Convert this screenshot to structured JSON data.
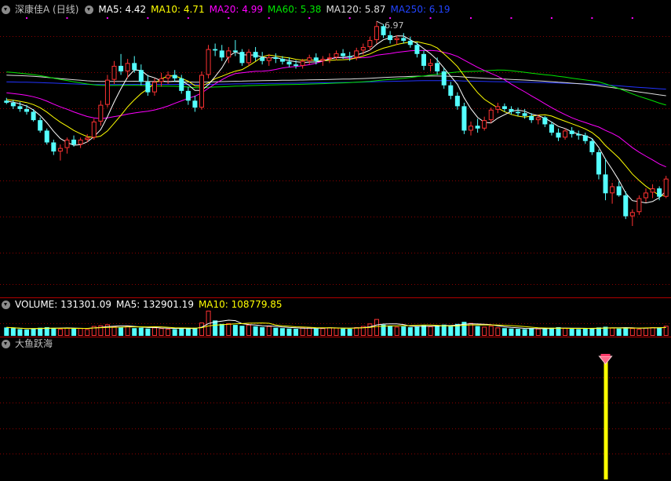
{
  "main_legend": {
    "stock": "深康佳A (日线)",
    "ma5": "MA5: 4.42",
    "ma10": "MA10: 4.71",
    "ma20": "MA20: 4.99",
    "ma60": "MA60: 5.38",
    "ma120": "MA120: 5.87",
    "ma250": "MA250: 6.19"
  },
  "volume_legend": {
    "vol": "VOLUME: 131301.09",
    "ma5": "MA5: 132901.19",
    "ma10": "MA10: 108779.85"
  },
  "indicator_legend": {
    "name": "大鱼跃海"
  },
  "colors": {
    "up": "#ff3232",
    "down": "#54ffff",
    "ma5": "#ffffff",
    "ma10": "#ffff00",
    "ma20": "#ff00ff",
    "ma60": "#00e600",
    "ma120": "#dddddd",
    "ma250": "#2233ff",
    "signal": "#ffff00",
    "grid": "#8b0000"
  },
  "chart_data": {
    "type": "candlestick",
    "peak_label": "6.97",
    "price_ylim": [
      3.2,
      7.2
    ],
    "candles": [
      [
        5.98,
        6.02,
        5.93,
        5.95
      ],
      [
        5.95,
        5.99,
        5.86,
        5.9
      ],
      [
        5.9,
        5.96,
        5.82,
        5.86
      ],
      [
        5.86,
        5.92,
        5.78,
        5.82
      ],
      [
        5.82,
        5.86,
        5.68,
        5.7
      ],
      [
        5.7,
        5.74,
        5.52,
        5.55
      ],
      [
        5.55,
        5.58,
        5.35,
        5.38
      ],
      [
        5.38,
        5.42,
        5.2,
        5.25
      ],
      [
        5.25,
        5.35,
        5.12,
        5.3
      ],
      [
        5.3,
        5.45,
        5.22,
        5.42
      ],
      [
        5.42,
        5.48,
        5.32,
        5.35
      ],
      [
        5.35,
        5.45,
        5.3,
        5.42
      ],
      [
        5.42,
        5.5,
        5.38,
        5.45
      ],
      [
        5.45,
        5.72,
        5.42,
        5.68
      ],
      [
        5.68,
        5.98,
        5.62,
        5.92
      ],
      [
        5.92,
        6.35,
        5.88,
        6.28
      ],
      [
        6.28,
        6.55,
        6.22,
        6.48
      ],
      [
        6.48,
        6.65,
        6.35,
        6.4
      ],
      [
        6.4,
        6.58,
        6.3,
        6.52
      ],
      [
        6.52,
        6.62,
        6.38,
        6.42
      ],
      [
        6.42,
        6.5,
        6.2,
        6.25
      ],
      [
        6.25,
        6.35,
        6.05,
        6.1
      ],
      [
        6.1,
        6.3,
        6.05,
        6.25
      ],
      [
        6.25,
        6.38,
        6.18,
        6.3
      ],
      [
        6.3,
        6.4,
        6.22,
        6.35
      ],
      [
        6.35,
        6.42,
        6.25,
        6.3
      ],
      [
        6.3,
        6.35,
        6.08,
        6.12
      ],
      [
        6.12,
        6.18,
        5.92,
        5.98
      ],
      [
        5.98,
        6.05,
        5.82,
        5.88
      ],
      [
        5.88,
        6.4,
        5.85,
        6.35
      ],
      [
        6.35,
        6.78,
        6.3,
        6.72
      ],
      [
        6.72,
        6.8,
        6.62,
        6.7
      ],
      [
        6.7,
        6.78,
        6.55,
        6.6
      ],
      [
        6.6,
        6.75,
        6.52,
        6.7
      ],
      [
        6.7,
        6.85,
        6.62,
        6.68
      ],
      [
        6.68,
        6.72,
        6.48,
        6.52
      ],
      [
        6.52,
        6.72,
        6.48,
        6.68
      ],
      [
        6.68,
        6.75,
        6.55,
        6.6
      ],
      [
        6.6,
        6.68,
        6.5,
        6.55
      ],
      [
        6.55,
        6.65,
        6.48,
        6.6
      ],
      [
        6.6,
        6.66,
        6.52,
        6.58
      ],
      [
        6.58,
        6.62,
        6.5,
        6.54
      ],
      [
        6.54,
        6.6,
        6.46,
        6.5
      ],
      [
        6.5,
        6.56,
        6.44,
        6.48
      ],
      [
        6.48,
        6.58,
        6.44,
        6.55
      ],
      [
        6.55,
        6.64,
        6.5,
        6.6
      ],
      [
        6.6,
        6.66,
        6.5,
        6.55
      ],
      [
        6.55,
        6.62,
        6.48,
        6.58
      ],
      [
        6.58,
        6.66,
        6.52,
        6.6
      ],
      [
        6.6,
        6.7,
        6.56,
        6.66
      ],
      [
        6.66,
        6.72,
        6.58,
        6.62
      ],
      [
        6.62,
        6.68,
        6.55,
        6.6
      ],
      [
        6.6,
        6.74,
        6.56,
        6.7
      ],
      [
        6.7,
        6.8,
        6.64,
        6.75
      ],
      [
        6.75,
        6.9,
        6.7,
        6.85
      ],
      [
        6.85,
        7.12,
        6.8,
        7.05
      ],
      [
        7.05,
        7.08,
        6.88,
        6.92
      ],
      [
        6.92,
        6.98,
        6.8,
        6.85
      ],
      [
        6.85,
        6.92,
        6.78,
        6.88
      ],
      [
        6.88,
        6.95,
        6.8,
        6.84
      ],
      [
        6.84,
        6.9,
        6.74,
        6.78
      ],
      [
        6.78,
        6.82,
        6.6,
        6.65
      ],
      [
        6.65,
        6.7,
        6.42,
        6.48
      ],
      [
        6.48,
        6.58,
        6.4,
        6.52
      ],
      [
        6.52,
        6.6,
        6.35,
        6.4
      ],
      [
        6.4,
        6.45,
        6.15,
        6.2
      ],
      [
        6.2,
        6.25,
        6.0,
        6.05
      ],
      [
        6.05,
        6.1,
        5.85,
        5.9
      ],
      [
        5.9,
        5.95,
        5.5,
        5.55
      ],
      [
        5.55,
        5.68,
        5.48,
        5.62
      ],
      [
        5.62,
        5.72,
        5.52,
        5.58
      ],
      [
        5.58,
        5.75,
        5.55,
        5.7
      ],
      [
        5.7,
        5.88,
        5.66,
        5.85
      ],
      [
        5.85,
        5.95,
        5.8,
        5.9
      ],
      [
        5.9,
        5.94,
        5.82,
        5.86
      ],
      [
        5.86,
        5.9,
        5.78,
        5.82
      ],
      [
        5.82,
        5.88,
        5.76,
        5.8
      ],
      [
        5.8,
        5.86,
        5.72,
        5.76
      ],
      [
        5.76,
        5.8,
        5.66,
        5.7
      ],
      [
        5.7,
        5.78,
        5.64,
        5.74
      ],
      [
        5.74,
        5.76,
        5.6,
        5.64
      ],
      [
        5.64,
        5.68,
        5.48,
        5.52
      ],
      [
        5.52,
        5.58,
        5.4,
        5.45
      ],
      [
        5.45,
        5.58,
        5.42,
        5.55
      ],
      [
        5.55,
        5.6,
        5.45,
        5.5
      ],
      [
        5.5,
        5.55,
        5.42,
        5.48
      ],
      [
        5.48,
        5.52,
        5.36,
        5.4
      ],
      [
        5.4,
        5.44,
        5.2,
        5.24
      ],
      [
        5.24,
        5.28,
        4.85,
        4.92
      ],
      [
        4.92,
        5.15,
        4.55,
        4.65
      ],
      [
        4.65,
        4.8,
        4.5,
        4.75
      ],
      [
        4.75,
        4.82,
        4.6,
        4.62
      ],
      [
        4.62,
        4.68,
        4.28,
        4.32
      ],
      [
        4.32,
        4.42,
        4.18,
        4.38
      ],
      [
        4.38,
        4.62,
        4.34,
        4.58
      ],
      [
        4.58,
        4.72,
        4.52,
        4.66
      ],
      [
        4.66,
        4.78,
        4.58,
        4.72
      ],
      [
        4.72,
        4.75,
        4.55,
        4.6
      ],
      [
        4.6,
        4.9,
        4.58,
        4.86
      ]
    ],
    "volumes": [
      60,
      55,
      48,
      45,
      52,
      58,
      62,
      55,
      50,
      58,
      52,
      55,
      48,
      70,
      75,
      82,
      68,
      60,
      72,
      55,
      58,
      52,
      60,
      55,
      50,
      48,
      56,
      52,
      58,
      95,
      180,
      110,
      85,
      90,
      78,
      72,
      80,
      68,
      62,
      70,
      58,
      55,
      52,
      50,
      60,
      58,
      52,
      55,
      60,
      58,
      52,
      50,
      62,
      70,
      88,
      120,
      80,
      72,
      65,
      68,
      62,
      70,
      75,
      68,
      72,
      80,
      75,
      85,
      100,
      92,
      70,
      65,
      72,
      60,
      55,
      52,
      50,
      48,
      55,
      52,
      50,
      58,
      62,
      56,
      50,
      48,
      52,
      55,
      60,
      65,
      58,
      52,
      60,
      55,
      50,
      58,
      62,
      60,
      72
    ],
    "vol_ylim": [
      0,
      420
    ],
    "signal_index": 89,
    "series": [
      {
        "name": "MA5"
      },
      {
        "name": "MA10"
      },
      {
        "name": "MA20"
      },
      {
        "name": "MA60"
      },
      {
        "name": "MA120"
      },
      {
        "name": "MA250"
      }
    ]
  }
}
